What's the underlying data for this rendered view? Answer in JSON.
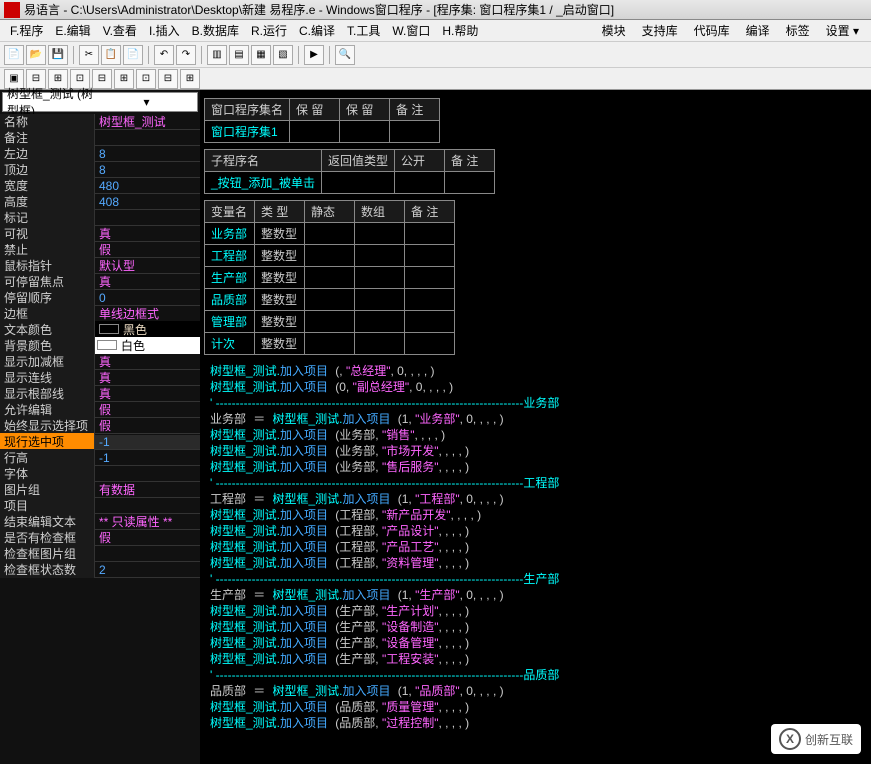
{
  "window": {
    "title": "易语言 - C:\\Users\\Administrator\\Desktop\\新建 易程序.e - Windows窗口程序 - [程序集: 窗口程序集1 / _启动窗口]"
  },
  "menu": {
    "items": [
      "F.程序",
      "E.编辑",
      "V.查看",
      "I.插入",
      "B.数据库",
      "R.运行",
      "C.编译",
      "T.工具",
      "W.窗口",
      "H.帮助"
    ],
    "right": [
      "模块",
      "支持库",
      "代码库",
      "编译",
      "标签",
      "设置 ▾"
    ]
  },
  "combo": {
    "value": "树型框_测试 (树型框)"
  },
  "properties": [
    {
      "name": "名称",
      "val": "树型框_测试",
      "cls": "val-pink"
    },
    {
      "name": "备注",
      "val": "",
      "cls": ""
    },
    {
      "name": "左边",
      "val": "8",
      "cls": "val-blue"
    },
    {
      "name": "顶边",
      "val": "8",
      "cls": "val-blue"
    },
    {
      "name": "宽度",
      "val": "480",
      "cls": "val-blue"
    },
    {
      "name": "高度",
      "val": "408",
      "cls": "val-blue"
    },
    {
      "name": "标记",
      "val": "",
      "cls": ""
    },
    {
      "name": "可视",
      "val": "真",
      "cls": "val-pink"
    },
    {
      "name": "禁止",
      "val": "假",
      "cls": "val-pink"
    },
    {
      "name": "鼠标指针",
      "val": "默认型",
      "cls": "val-pink"
    },
    {
      "name": "可停留焦点",
      "val": "真",
      "cls": "val-pink"
    },
    {
      "name": "停留顺序",
      "val": "0",
      "cls": "val-blue"
    },
    {
      "name": "边框",
      "val": "单线边框式",
      "cls": "val-pink"
    },
    {
      "name": "文本颜色",
      "val": "黑色",
      "cls": "val-black"
    },
    {
      "name": "背景颜色",
      "val": "白色",
      "cls": "val-whitebg"
    },
    {
      "name": "显示加减框",
      "val": "真",
      "cls": "val-pink"
    },
    {
      "name": "显示连线",
      "val": "真",
      "cls": "val-pink"
    },
    {
      "name": "显示根部线",
      "val": "真",
      "cls": "val-pink"
    },
    {
      "name": "允许编辑",
      "val": "假",
      "cls": "val-pink"
    },
    {
      "name": "始终显示选择项",
      "val": "假",
      "cls": "val-pink"
    },
    {
      "name": "现行选中项",
      "val": "-1",
      "cls": "val-blue",
      "selected": true
    },
    {
      "name": "行高",
      "val": "-1",
      "cls": "val-blue"
    },
    {
      "name": "字体",
      "val": "",
      "cls": ""
    },
    {
      "name": "图片组",
      "val": "有数据",
      "cls": "val-pink"
    },
    {
      "name": "项目",
      "val": "",
      "cls": ""
    },
    {
      "name": "结束编辑文本",
      "val": "** 只读属性 **",
      "cls": "val-pink"
    },
    {
      "name": "是否有检查框",
      "val": "假",
      "cls": "val-pink"
    },
    {
      "name": "检查框图片组",
      "val": "",
      "cls": ""
    },
    {
      "name": "检查框状态数",
      "val": "2",
      "cls": "val-blue"
    }
  ],
  "table1": {
    "headers": [
      "窗口程序集名",
      "保  留",
      "保  留",
      "备  注"
    ],
    "row": [
      "窗口程序集1",
      "",
      "",
      ""
    ]
  },
  "table2": {
    "headers": [
      "子程序名",
      "返回值类型",
      "公开",
      "备  注"
    ],
    "row": [
      "_按钮_添加_被单击",
      "",
      "",
      ""
    ]
  },
  "table3": {
    "headers": [
      "变量名",
      "类  型",
      "静态",
      "数组",
      "备  注"
    ],
    "rows": [
      [
        "业务部",
        "整数型",
        "",
        "",
        ""
      ],
      [
        "工程部",
        "整数型",
        "",
        "",
        ""
      ],
      [
        "生产部",
        "整数型",
        "",
        "",
        ""
      ],
      [
        "品质部",
        "整数型",
        "",
        "",
        ""
      ],
      [
        "管理部",
        "整数型",
        "",
        "",
        ""
      ],
      [
        "计次",
        "整数型",
        "",
        "",
        ""
      ]
    ]
  },
  "code": {
    "obj": "树型框_测试.",
    "method": "加入项目",
    "l1a": "\"总经理\"",
    "l1b": "\"副总经理\"",
    "sec_biz": "业务部",
    "biz_items": [
      "\"业务部\"",
      "\"销售\"",
      "\"市场开发\"",
      "\"售后服务\""
    ],
    "sec_eng": "工程部",
    "eng_items": [
      "\"工程部\"",
      "\"新产品开发\"",
      "\"产品设计\"",
      "\"产品工艺\"",
      "\"资料管理\""
    ],
    "sec_prod": "生产部",
    "prod_items": [
      "\"生产部\"",
      "\"生产计划\"",
      "\"设备制造\"",
      "\"设备管理\"",
      "\"工程安装\""
    ],
    "sec_qual": "品质部",
    "qual_items": [
      "\"品质部\"",
      "\"质量管理\"",
      "\"过程控制\""
    ]
  },
  "watermark": "创新互联"
}
